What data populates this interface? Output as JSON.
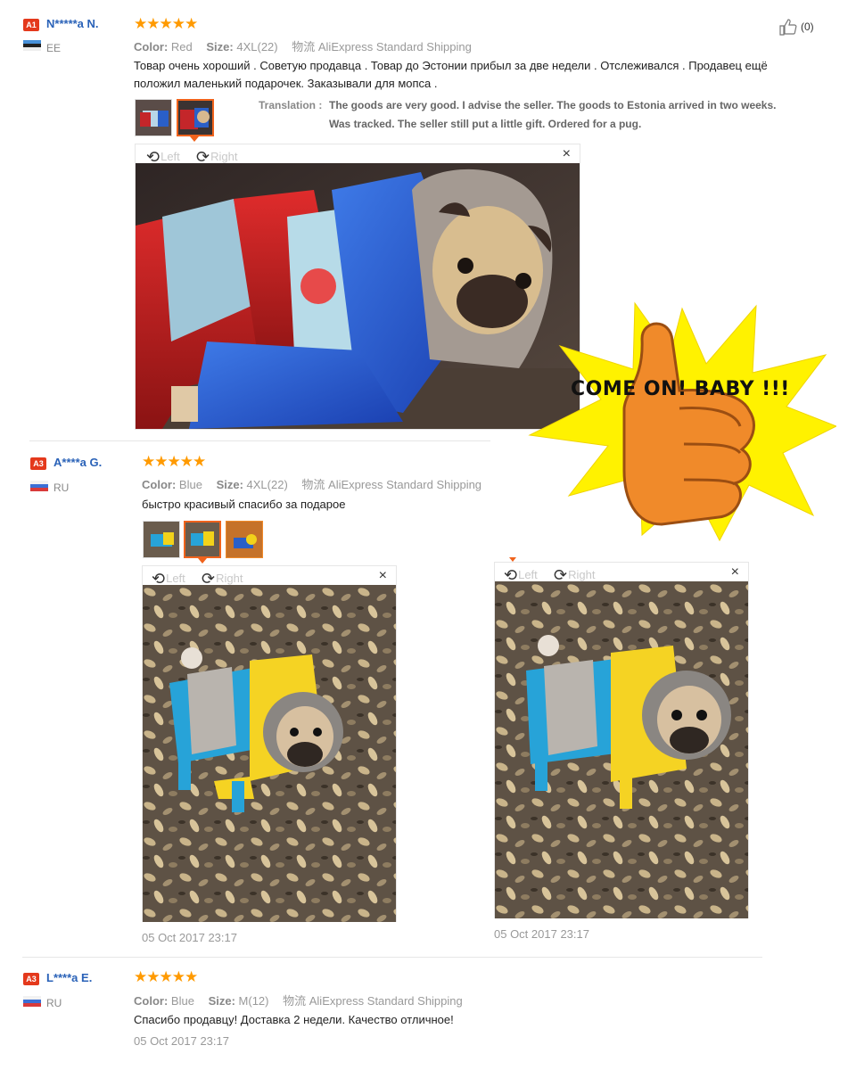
{
  "reviews": [
    {
      "level": "A1",
      "user": "N*****a N.",
      "country": "EE",
      "stars": "★★★★★",
      "color_label": "Color:",
      "color": "Red",
      "size_label": "Size:",
      "size": "4XL(22)",
      "logistics_label": "物流",
      "shipping": "AliExpress Standard Shipping",
      "text": "Товар очень хороший . Советую продавца . Товар до Эстонии прибыл за две недели . Отслеживался . Продавец ещё положил маленький подарочек. Заказывали для мопса .",
      "helpful": "(0)",
      "translation_label": "Translation :",
      "translation_line1": "The goods are very good. I advise the seller. The goods to Estonia arrived in two weeks.",
      "translation_line2": "Was tracked. The seller still put a little gift. Ordered for a pug."
    },
    {
      "level": "A3",
      "user": "A****a G.",
      "country": "RU",
      "stars": "★★★★★",
      "color_label": "Color:",
      "color": "Blue",
      "size_label": "Size:",
      "size": "4XL(22)",
      "logistics_label": "物流",
      "shipping": "AliExpress Standard Shipping",
      "text": "быстро красивый спасибо за подарое",
      "date": "05 Oct 2017 23:17",
      "date2": "05 Oct 2017 23:17"
    },
    {
      "level": "A3",
      "user": "L****a E.",
      "country": "RU",
      "stars": "★★★★★",
      "color_label": "Color:",
      "color": "Blue",
      "size_label": "Size:",
      "size": "M(12)",
      "logistics_label": "物流",
      "shipping": "AliExpress Standard Shipping",
      "text": "Спасибо продавцу! Доставка 2 недели. Качество отличное!",
      "date": "05 Oct 2017 23:17"
    }
  ],
  "viewer": {
    "left": "Left",
    "right": "Right",
    "close": "×"
  },
  "promo": {
    "text": "COME ON! BABY !!!"
  },
  "colors": {
    "accent": "#f0631c",
    "star": "#ff9a00",
    "username": "#2a62b8",
    "badge": "#e4391c",
    "promo_star": "#fff200",
    "thumb": "#f08a2a"
  },
  "icons": [
    "thumbs-up-icon",
    "rotate-left-icon",
    "rotate-right-icon",
    "close-icon",
    "flag-estonia-icon",
    "flag-russia-icon"
  ]
}
